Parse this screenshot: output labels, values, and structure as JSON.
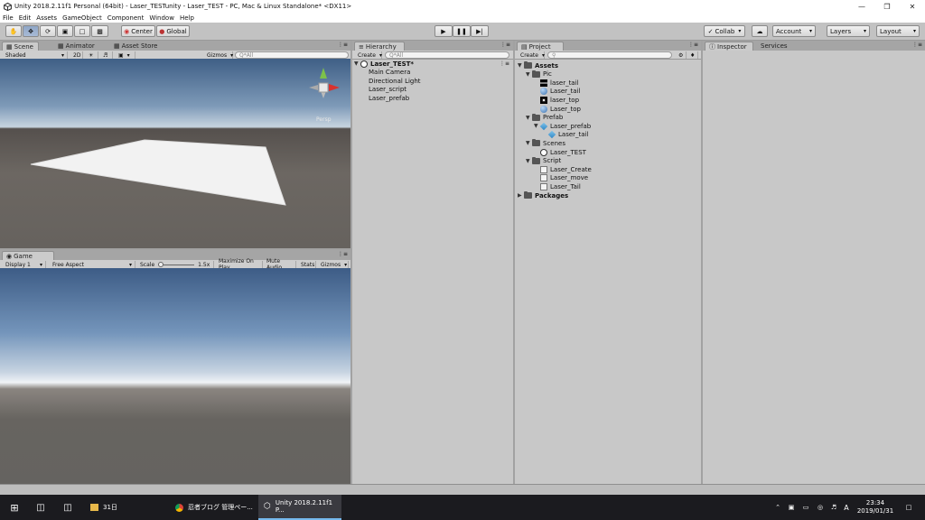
{
  "window": {
    "title": "Unity 2018.2.11f1 Personal (64bit) - Laser_TESTunity - Laser_TEST - PC, Mac & Linux Standalone* <DX11>"
  },
  "menu": [
    "File",
    "Edit",
    "Assets",
    "GameObject",
    "Component",
    "Window",
    "Help"
  ],
  "toolbar": {
    "pivot": "Center",
    "space": "Global",
    "collab": "Collab",
    "account": "Account",
    "layers": "Layers",
    "layout": "Layout"
  },
  "scene": {
    "tabs": [
      "Scene",
      "Animator",
      "Asset Store"
    ],
    "shading": "Shaded",
    "mode2d": "2D",
    "gizmos": "Gizmos",
    "search_placeholder": "Q*All",
    "persp": "Persp"
  },
  "game": {
    "tab": "Game",
    "display": "Display 1",
    "aspect": "Free Aspect",
    "scale_label": "Scale",
    "scale_value": "1.5x",
    "maximize": "Maximize On Play",
    "mute": "Mute Audio",
    "stats": "Stats",
    "gizmos": "Gizmos"
  },
  "hierarchy": {
    "tab": "Hierarchy",
    "create": "Create",
    "search_placeholder": "Q*All",
    "scene_name": "Laser_TEST*",
    "items": [
      "Main Camera",
      "Directional Light",
      "Laser_script",
      "Laser_prefab"
    ]
  },
  "project": {
    "tab": "Project",
    "create": "Create",
    "tree": [
      {
        "label": "Assets",
        "type": "folder",
        "depth": 0,
        "open": true,
        "bold": true
      },
      {
        "label": "Pic",
        "type": "folder",
        "depth": 1,
        "open": true
      },
      {
        "label": "laser_tail",
        "type": "img",
        "depth": 2
      },
      {
        "label": "Laser_tail",
        "type": "mat",
        "depth": 2
      },
      {
        "label": "laser_top",
        "type": "imgspark",
        "depth": 2
      },
      {
        "label": "Laser_top",
        "type": "mat",
        "depth": 2
      },
      {
        "label": "Prefab",
        "type": "folder",
        "depth": 1,
        "open": true
      },
      {
        "label": "Laser_prefab",
        "type": "prefab",
        "depth": 2,
        "open": true
      },
      {
        "label": "Laser_tail",
        "type": "prefab",
        "depth": 3
      },
      {
        "label": "Scenes",
        "type": "folder",
        "depth": 1,
        "open": true
      },
      {
        "label": "Laser_TEST",
        "type": "unity",
        "depth": 2
      },
      {
        "label": "Script",
        "type": "folder",
        "depth": 1,
        "open": true
      },
      {
        "label": "Laser_Create",
        "type": "script",
        "depth": 2
      },
      {
        "label": "Laser_move",
        "type": "script",
        "depth": 2
      },
      {
        "label": "Laser_Tail",
        "type": "script",
        "depth": 2
      },
      {
        "label": "Packages",
        "type": "folder",
        "depth": 0,
        "open": false,
        "bold": true
      }
    ]
  },
  "inspector": {
    "tabs": [
      "Inspector",
      "Services"
    ]
  },
  "taskbar": {
    "items": [
      "31日",
      "忍者ブログ 管理ペー...",
      "Unity 2018.2.11f1 P..."
    ],
    "time": "23:34",
    "date": "2019/01/31",
    "ime": "A"
  }
}
